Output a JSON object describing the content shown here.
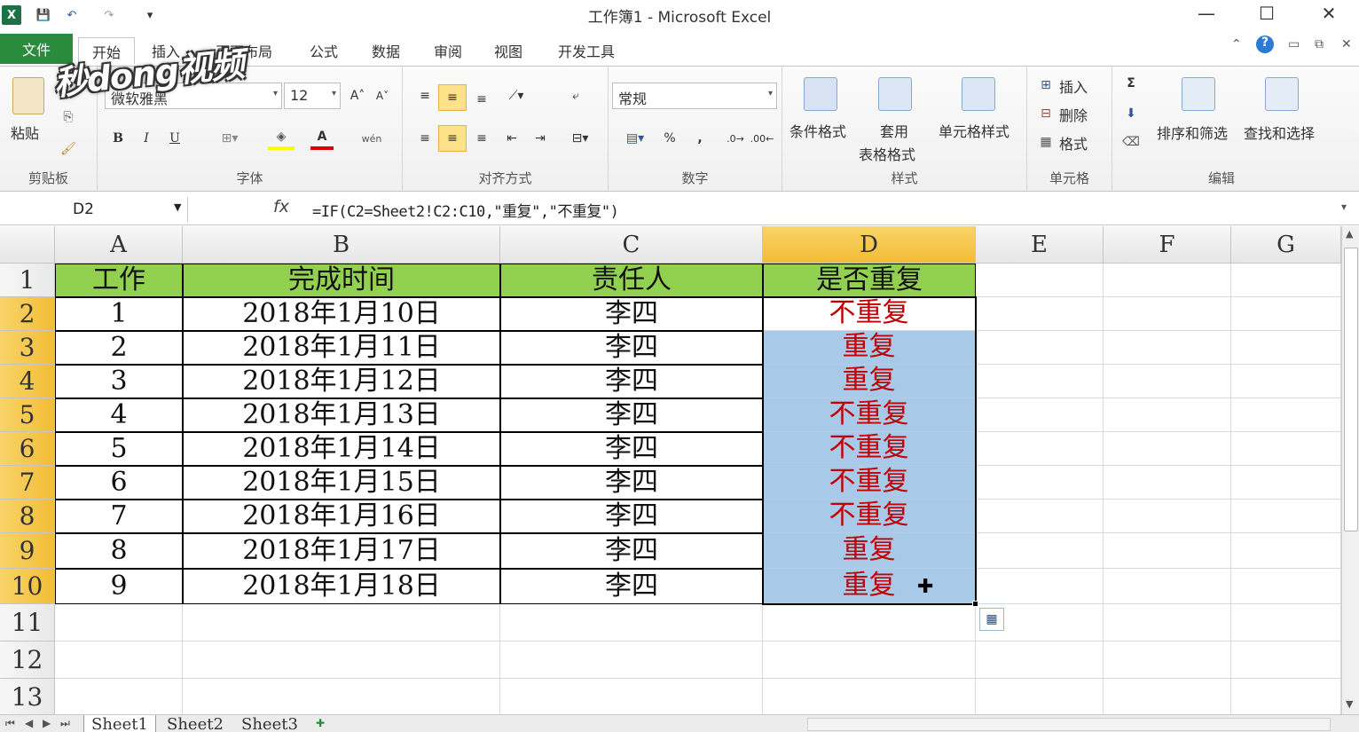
{
  "window": {
    "title": "工作簿1 - Microsoft Excel",
    "minimize": "—",
    "maximize": "☐",
    "close": "✕"
  },
  "quick_access": {
    "excel_logo": "X",
    "save": "💾",
    "undo": "↶",
    "redo": "↷",
    "customize": "▾"
  },
  "tabs": [
    {
      "label": "文件"
    },
    {
      "label": "开始"
    },
    {
      "label": "插入"
    },
    {
      "label": "页面布局"
    },
    {
      "label": "公式"
    },
    {
      "label": "数据"
    },
    {
      "label": "审阅"
    },
    {
      "label": "视图"
    },
    {
      "label": "开发工具"
    }
  ],
  "ribbon": {
    "clipboard": {
      "paste": "粘贴",
      "group": "剪贴板"
    },
    "font": {
      "name": "微软雅黑",
      "size": "12",
      "bold": "B",
      "italic": "I",
      "underline": "U",
      "grow": "A˄",
      "shrink": "A˅",
      "font_color": "A",
      "wen": "wén",
      "group": "字体"
    },
    "alignment": {
      "group": "对齐方式"
    },
    "number": {
      "format": "常规",
      "percent": "%",
      "comma": ",",
      "group": "数字"
    },
    "styles": {
      "conditional": "条件格式",
      "table_line1": "套用",
      "table_line2": "表格格式",
      "cell_styles": "单元格样式",
      "group": "样式"
    },
    "cells": {
      "insert": "插入",
      "delete": "删除",
      "format": "格式",
      "group": "单元格"
    },
    "editing": {
      "sum": "Σ",
      "sort_filter": "排序和筛选",
      "find_select": "查找和选择",
      "group": "编辑"
    }
  },
  "watermark": "秒dong视频",
  "formula_bar": {
    "name_box": "D2",
    "fx": "fx",
    "formula": "=IF(C2=Sheet2!C2:C10,\"重复\",\"不重复\")"
  },
  "grid": {
    "columns": [
      "A",
      "B",
      "C",
      "D",
      "E",
      "F",
      "G"
    ],
    "selected_column": "D",
    "rows": [
      "1",
      "2",
      "3",
      "4",
      "5",
      "6",
      "7",
      "8",
      "9",
      "10",
      "11",
      "12",
      "13"
    ],
    "header_row": [
      "工作",
      "完成时间",
      "责任人",
      "是否重复"
    ],
    "data": [
      [
        "1",
        "2018年1月10日",
        "李四",
        "不重复"
      ],
      [
        "2",
        "2018年1月11日",
        "李四",
        "重复"
      ],
      [
        "3",
        "2018年1月12日",
        "李四",
        "重复"
      ],
      [
        "4",
        "2018年1月13日",
        "李四",
        "不重复"
      ],
      [
        "5",
        "2018年1月14日",
        "李四",
        "不重复"
      ],
      [
        "6",
        "2018年1月15日",
        "李四",
        "不重复"
      ],
      [
        "7",
        "2018年1月16日",
        "李四",
        "不重复"
      ],
      [
        "8",
        "2018年1月17日",
        "李四",
        "重复"
      ],
      [
        "9",
        "2018年1月18日",
        "李四",
        "重复"
      ]
    ],
    "header_fill": "#92d050",
    "selection_fill": "#a9c9e8",
    "result_text_color": "#c00000"
  },
  "sheets": [
    {
      "name": "Sheet1",
      "active": true
    },
    {
      "name": "Sheet2",
      "active": false
    },
    {
      "name": "Sheet3",
      "active": false
    }
  ]
}
